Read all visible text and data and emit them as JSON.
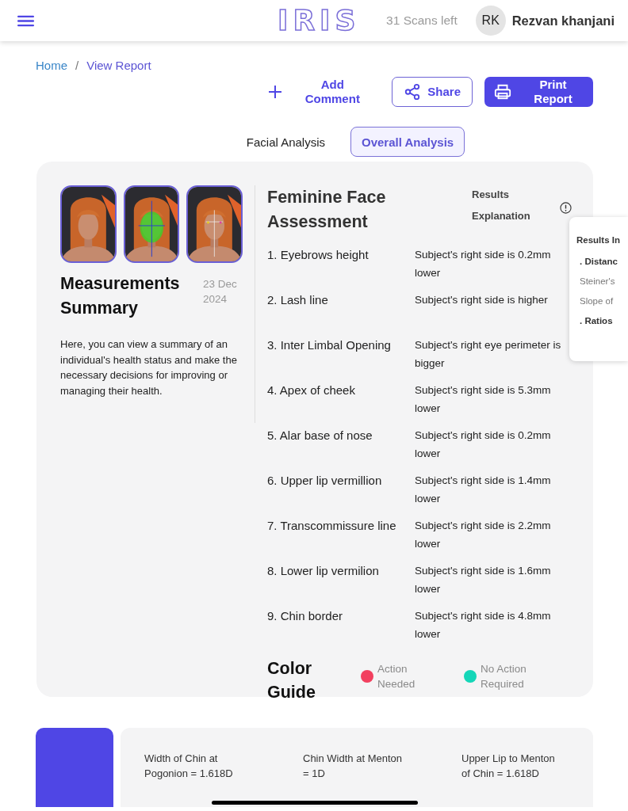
{
  "header": {
    "logo": "IRIS",
    "scans_left": "31 Scans left",
    "avatar_initials": "RK",
    "user_name": "Rezvan khanjani"
  },
  "breadcrumb": [
    {
      "label": "Home",
      "selected": false
    },
    {
      "label": "View Report",
      "selected": true
    }
  ],
  "breadcrumb_separator": "/",
  "actions": [
    {
      "kind": "add",
      "label": "Add Comment"
    },
    {
      "kind": "share",
      "label": "Share"
    },
    {
      "kind": "print",
      "label": "Print Report"
    }
  ],
  "tabs": [
    {
      "label": "Facial Analysis",
      "selected": false
    },
    {
      "label": "Overall Analysis",
      "selected": true
    }
  ],
  "summary": {
    "title": "Measurements Summary",
    "date": "23 Dec 2024",
    "description": "Here, you can view a summary of an individual's health status and make the necessary decisions for improving or managing their health."
  },
  "assessment": {
    "title": "Feminine Face Assessment",
    "column_headers": [
      "Results",
      "Explanation"
    ],
    "rows": [
      {
        "label": "1. Eyebrows height",
        "result": "Subject's right side is 0.2mm lower"
      },
      {
        "label": "2. Lash line",
        "result": "Subject's right side is higher"
      },
      {
        "label": "3. Inter Limbal Opening",
        "result": "Subject's right eye perimeter is bigger"
      },
      {
        "label": "4. Apex of cheek",
        "result": "Subject's right side is 5.3mm lower"
      },
      {
        "label": "5. Alar base of nose",
        "result": "Subject's right side is 0.2mm lower"
      },
      {
        "label": "6. Upper lip vermillion",
        "result": "Subject's right side is 1.4mm lower"
      },
      {
        "label": "7. Transcommissure line",
        "result": "Subject's right side is 2.2mm lower"
      },
      {
        "label": "8. Lower lip vermilion",
        "result": "Subject's right side is 1.6mm lower"
      },
      {
        "label": "9. Chin border",
        "result": "Subject's right side is 4.8mm lower"
      }
    ]
  },
  "color_guide": {
    "title": "Color Guide",
    "items": [
      {
        "label": "Action Needed",
        "color": "#f2405f"
      },
      {
        "label": "No Action Required",
        "color": "#14d6b8"
      }
    ]
  },
  "popup": {
    "title": "Results In",
    "items": [
      {
        "kind": "heading",
        "text": ". Distanc"
      },
      {
        "kind": "item",
        "text": "Steiner's"
      },
      {
        "kind": "item",
        "text": "Slope of"
      },
      {
        "kind": "heading",
        "text": ". Ratios"
      }
    ]
  },
  "ratios": [
    "Width of Chin at Pogonion = 1.618D",
    "Chin Width at Menton = 1D",
    "Upper Lip to Menton of Chin = 1.618D"
  ]
}
